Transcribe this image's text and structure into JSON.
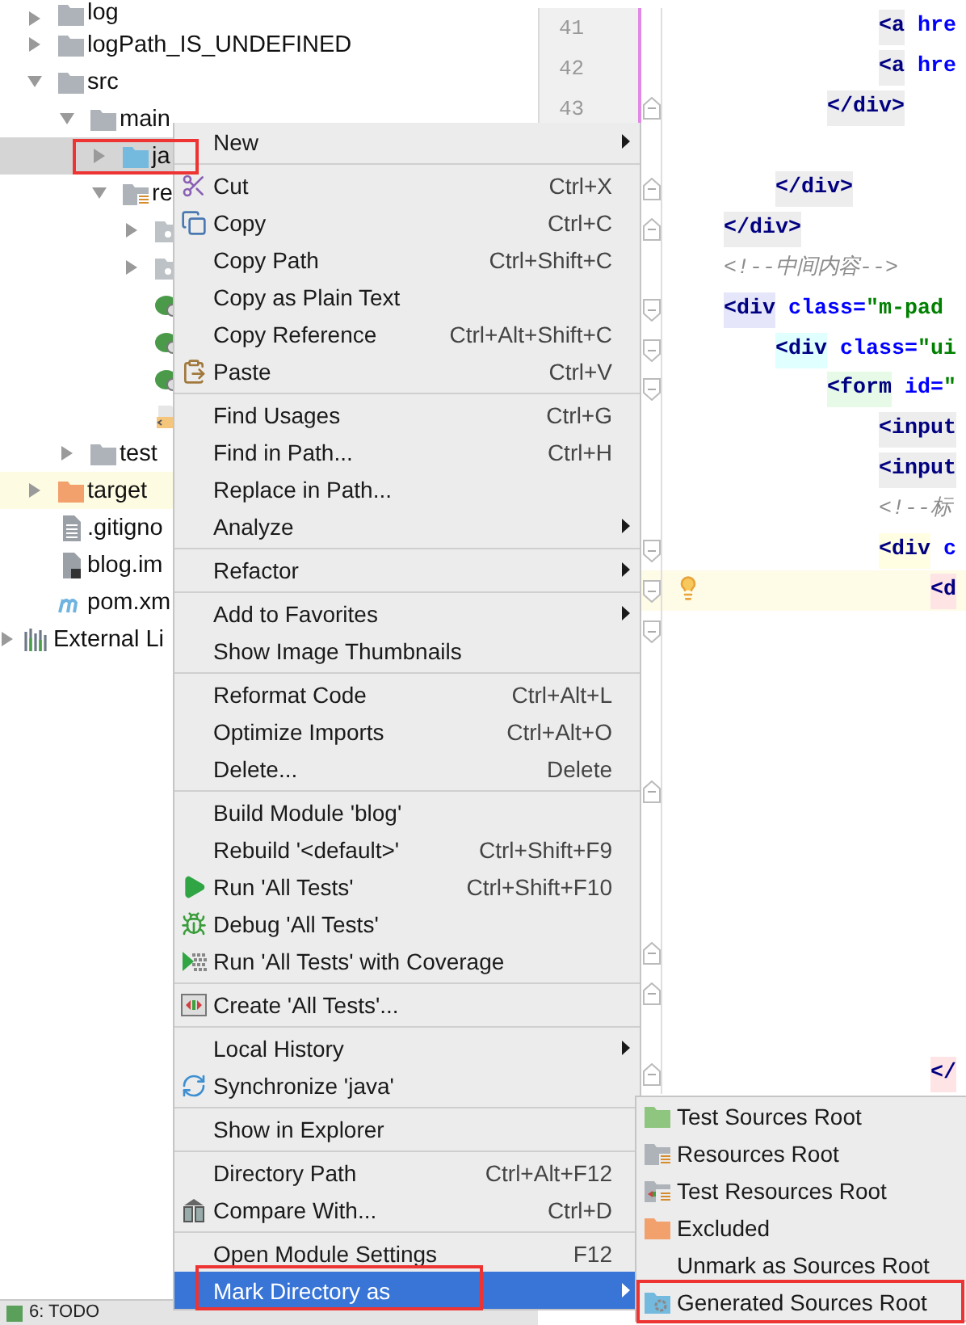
{
  "project_tree": {
    "items": [
      {
        "label": "log",
        "kind": "folder",
        "expanded": false,
        "selected": false
      },
      {
        "label": "logPath_IS_UNDEFINED",
        "kind": "folder",
        "expanded": false,
        "selected": false
      },
      {
        "label": "src",
        "kind": "folder",
        "expanded": true,
        "selected": false,
        "children": [
          {
            "label": "main",
            "kind": "folder",
            "expanded": true,
            "selected": false,
            "children": [
              {
                "label": "ja",
                "kind": "source_root",
                "expanded": false,
                "selected": true,
                "annotated": true
              },
              {
                "label": "re",
                "kind": "resources_root",
                "expanded": true,
                "selected": false,
                "children": [
                  {
                    "kind": "package",
                    "expanded": false,
                    "selected": false
                  },
                  {
                    "kind": "package",
                    "expanded": false,
                    "selected": false
                  },
                  {
                    "kind": "spring_file",
                    "selected": false
                  },
                  {
                    "kind": "spring_file",
                    "selected": false
                  },
                  {
                    "kind": "spring_file",
                    "selected": false
                  },
                  {
                    "kind": "xml_file",
                    "selected": false
                  }
                ]
              }
            ]
          },
          {
            "label": "test",
            "kind": "folder",
            "expanded": false,
            "selected": false
          }
        ]
      },
      {
        "label": "target",
        "kind": "excluded",
        "expanded": false,
        "selected": false
      },
      {
        "label": ".gitigno",
        "kind": "text_file",
        "selected": false
      },
      {
        "label": "blog.im",
        "kind": "module_file",
        "selected": false
      },
      {
        "label": "pom.xm",
        "kind": "maven_file",
        "selected": false
      }
    ]
  },
  "external_libraries": {
    "label": "External Li",
    "expanded": false,
    "selected": false
  },
  "tool_window_bar": {
    "label": "6: TODO"
  },
  "editor": {
    "lines": [
      {
        "number": "41",
        "changed": true,
        "caret_line": false,
        "segments": [
          {
            "text": "                <a",
            "kind": "tag",
            "color": "#ededed"
          },
          {
            "text": " hre",
            "kind": "attr"
          }
        ]
      },
      {
        "number": "42",
        "changed": true,
        "caret_line": false,
        "segments": [
          {
            "text": "                <a",
            "kind": "tag",
            "color": "#ededed"
          },
          {
            "text": " hre",
            "kind": "attr"
          }
        ]
      },
      {
        "number": "43",
        "changed": true,
        "caret_line": false,
        "fold_end": true,
        "segments": [
          {
            "text": "            </div>",
            "kind": "tag",
            "color": "#ededed"
          }
        ]
      },
      {
        "caret_line": false
      },
      {
        "caret_line": false,
        "fold_end": true,
        "segments": [
          {
            "text": "        </div>",
            "kind": "tag",
            "color": "#ededed"
          }
        ]
      },
      {
        "caret_line": false,
        "fold_end": true,
        "segments": [
          {
            "text": "    </div>",
            "kind": "tag",
            "color": "#ededed"
          }
        ]
      },
      {
        "caret_line": false,
        "segments": [
          {
            "text": "    <!--中间内容-->",
            "kind": "comment"
          }
        ]
      },
      {
        "caret_line": false,
        "fold_start": true,
        "segments": [
          {
            "text": "    <div",
            "kind": "tag",
            "color": "#e6e6fa"
          },
          {
            "text": " class=",
            "kind": "attr"
          },
          {
            "text": "\"m-pad",
            "kind": "value"
          }
        ]
      },
      {
        "caret_line": false,
        "fold_start": true,
        "segments": [
          {
            "text": "        <div",
            "kind": "tag",
            "color": "#e0ffff"
          },
          {
            "text": " class=",
            "kind": "attr"
          },
          {
            "text": "\"ui",
            "kind": "value"
          }
        ]
      },
      {
        "caret_line": false,
        "fold_start": true,
        "segments": [
          {
            "text": "            <form",
            "kind": "tag",
            "color": "#e7f9e7"
          },
          {
            "text": " id=",
            "kind": "attr"
          },
          {
            "text": "\"",
            "kind": "value"
          }
        ]
      },
      {
        "caret_line": false,
        "segments": [
          {
            "text": "                <input",
            "kind": "tag",
            "color": "#ededed"
          }
        ]
      },
      {
        "caret_line": false,
        "segments": [
          {
            "text": "                <input",
            "kind": "tag",
            "color": "#ededed"
          }
        ]
      },
      {
        "caret_line": false,
        "segments": [
          {
            "text": "                <!--标",
            "kind": "comment"
          }
        ]
      },
      {
        "caret_line": false,
        "fold_start": true,
        "segments": [
          {
            "text": "                <div",
            "kind": "tag",
            "color": "#fffde2"
          },
          {
            "text": " c",
            "kind": "attr"
          }
        ]
      },
      {
        "caret_line": true,
        "fold_start": true,
        "intention": true,
        "segments": [
          {
            "text": "                    <d",
            "kind": "tag",
            "color": "#ffe4e6"
          }
        ]
      },
      {
        "caret_line": false,
        "fold_start": true
      },
      {
        "caret_line": false
      },
      {
        "caret_line": false
      },
      {
        "caret_line": false
      },
      {
        "caret_line": false,
        "fold_end": true
      },
      {
        "caret_line": false
      },
      {
        "caret_line": false
      },
      {
        "caret_line": false
      },
      {
        "caret_line": false,
        "fold_end": true
      },
      {
        "caret_line": false,
        "fold_end": true
      },
      {
        "caret_line": false
      },
      {
        "caret_line": false,
        "fold_end": true,
        "segments": [
          {
            "text": "                    </",
            "kind": "tag",
            "color": "#ffe4e6"
          }
        ]
      }
    ]
  },
  "context_menu": {
    "groups": [
      [
        {
          "label": "New",
          "submenu": true,
          "selected": false
        }
      ],
      [
        {
          "label": "Cut",
          "shortcut": "Ctrl+X",
          "selected": false
        },
        {
          "label": "Copy",
          "shortcut": "Ctrl+C",
          "selected": false
        },
        {
          "label": "Copy Path",
          "shortcut": "Ctrl+Shift+C",
          "selected": false
        },
        {
          "label": "Copy as Plain Text",
          "selected": false
        },
        {
          "label": "Copy Reference",
          "shortcut": "Ctrl+Alt+Shift+C",
          "selected": false
        },
        {
          "label": "Paste",
          "shortcut": "Ctrl+V",
          "selected": false
        }
      ],
      [
        {
          "label": "Find Usages",
          "shortcut": "Ctrl+G",
          "selected": false
        },
        {
          "label": "Find in Path...",
          "shortcut": "Ctrl+H",
          "selected": false
        },
        {
          "label": "Replace in Path...",
          "selected": false
        },
        {
          "label": "Analyze",
          "submenu": true,
          "selected": false
        }
      ],
      [
        {
          "label": "Refactor",
          "submenu": true,
          "selected": false
        }
      ],
      [
        {
          "label": "Add to Favorites",
          "submenu": true,
          "selected": false
        },
        {
          "label": "Show Image Thumbnails",
          "selected": false
        }
      ],
      [
        {
          "label": "Reformat Code",
          "shortcut": "Ctrl+Alt+L",
          "selected": false
        },
        {
          "label": "Optimize Imports",
          "shortcut": "Ctrl+Alt+O",
          "selected": false
        },
        {
          "label": "Delete...",
          "shortcut": "Delete",
          "selected": false
        }
      ],
      [
        {
          "label": "Build Module 'blog'",
          "selected": false
        },
        {
          "label": "Rebuild '<default>'",
          "shortcut": "Ctrl+Shift+F9",
          "selected": false
        },
        {
          "label": "Run 'All Tests'",
          "shortcut": "Ctrl+Shift+F10",
          "selected": false
        },
        {
          "label": "Debug 'All Tests'",
          "selected": false
        },
        {
          "label": "Run 'All Tests' with Coverage",
          "selected": false
        }
      ],
      [
        {
          "label": "Create 'All Tests'...",
          "selected": false
        }
      ],
      [
        {
          "label": "Local History",
          "submenu": true,
          "selected": false
        },
        {
          "label": "Synchronize 'java'",
          "selected": false
        }
      ],
      [
        {
          "label": "Show in Explorer",
          "selected": false
        }
      ],
      [
        {
          "label": "Directory Path",
          "shortcut": "Ctrl+Alt+F12",
          "selected": false
        },
        {
          "label": "Compare With...",
          "shortcut": "Ctrl+D",
          "selected": false
        }
      ],
      [
        {
          "label": "Open Module Settings",
          "shortcut": "F12",
          "selected": false
        },
        {
          "label": "Mark Directory as",
          "submenu": true,
          "selected": true,
          "annotated": true
        }
      ]
    ]
  },
  "submenu": {
    "items": [
      {
        "label": "Test Sources Root",
        "selected": false
      },
      {
        "label": "Resources Root",
        "selected": false
      },
      {
        "label": "Test Resources Root",
        "selected": false
      },
      {
        "label": "Excluded",
        "selected": false
      },
      {
        "label": "Unmark as Sources Root",
        "selected": false
      },
      {
        "label": "Generated Sources Root",
        "selected": false,
        "annotated": true
      }
    ]
  }
}
